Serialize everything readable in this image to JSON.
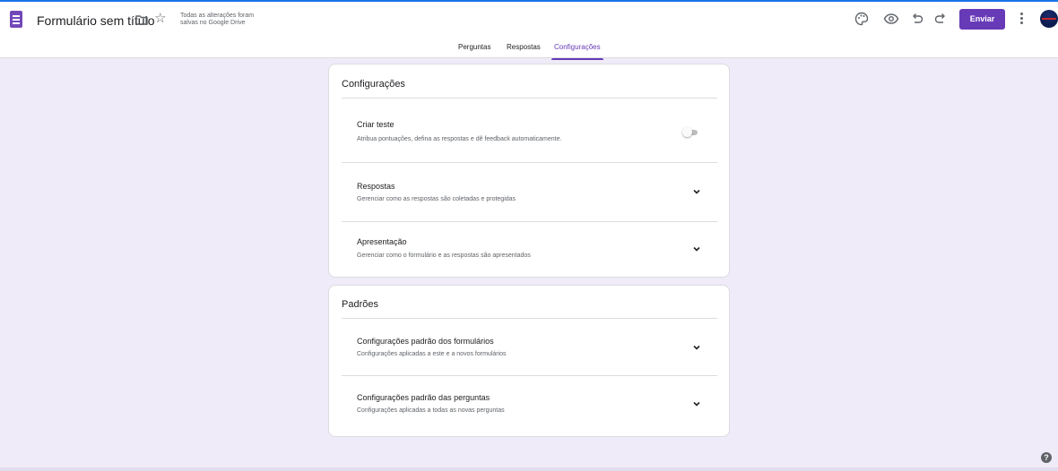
{
  "header": {
    "title": "Formulário sem título",
    "save_status_line1": "Todas as alterações foram",
    "save_status_line2": "salvas no Google Drive",
    "send_label": "Enviar",
    "icons": [
      "forms-logo-icon",
      "folder-icon",
      "star-icon",
      "palette-icon",
      "preview-eye-icon",
      "undo-icon",
      "redo-icon",
      "more-vert-icon",
      "avatar"
    ]
  },
  "tabs": [
    {
      "label": "Perguntas"
    },
    {
      "label": "Respostas"
    },
    {
      "label": "Configurações",
      "active": true
    }
  ],
  "settings_card": {
    "title": "Configurações",
    "sections": [
      {
        "title": "Criar teste",
        "description": "Atribua pontuações, defina as respostas e dê feedback automaticamente.",
        "control": "toggle",
        "enabled": false
      },
      {
        "title": "Respostas",
        "description": "Gerenciar como as respostas são coletadas e protegidas",
        "control": "chevron-down-icon"
      },
      {
        "title": "Apresentação",
        "description": "Gerenciar como o formulário e as respostas são apresentados",
        "control": "chevron-down-icon"
      }
    ]
  },
  "defaults_card": {
    "title": "Padrões",
    "sections": [
      {
        "title": "Configurações padrão dos formulários",
        "description": "Configurações aplicadas a este e a novos formulários",
        "control": "chevron-down-icon"
      },
      {
        "title": "Configurações padrão das perguntas",
        "description": "Configurações aplicadas a todas as novas perguntas",
        "control": "chevron-down-icon"
      }
    ]
  },
  "help": {
    "label": "?"
  },
  "colors": {
    "accent": "#673ab7",
    "background": "#f0ebf8",
    "top_border": "#1a73e8"
  }
}
